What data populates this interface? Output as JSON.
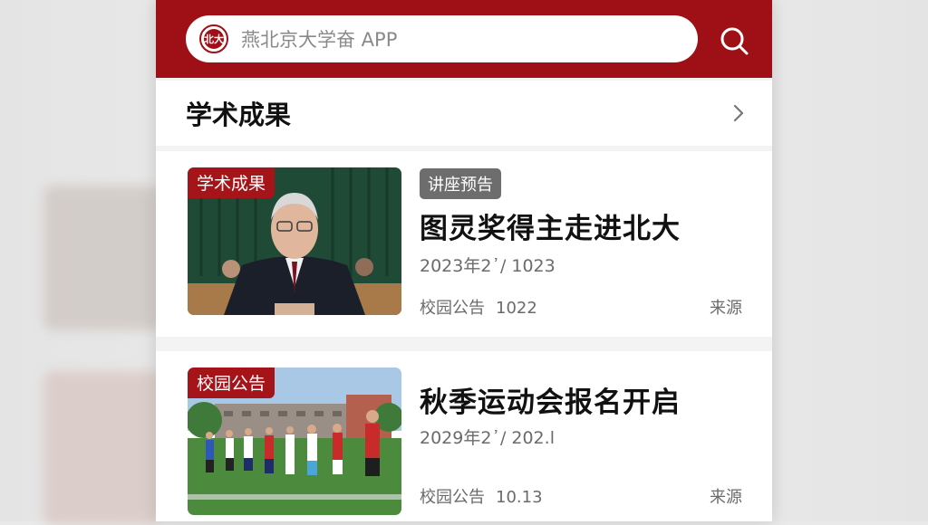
{
  "search": {
    "placeholder": "燕北京大学奋 APP",
    "logo_text": "北大"
  },
  "section": {
    "title": "学术成果"
  },
  "articles": [
    {
      "thumb_tag": "学术成果",
      "chip": "讲座预告",
      "title": "图灵奖得主走进北大",
      "date": "2023年2᾿/ 1023",
      "category": "校园公告",
      "count": "1022",
      "source": "来源"
    },
    {
      "thumb_tag": "校园公告",
      "title": "秋季运动会报名开启",
      "date": "2029年2᾿/ 202.l",
      "category": "校园公告",
      "count": "10.13",
      "source": "来源"
    }
  ],
  "colors": {
    "brand": "#9e1015",
    "tag": "#a51419",
    "chip": "#6d6d6d"
  },
  "icons": {
    "search": "search-icon",
    "chevron": "chevron-right-icon",
    "logo": "university-logo-icon"
  }
}
